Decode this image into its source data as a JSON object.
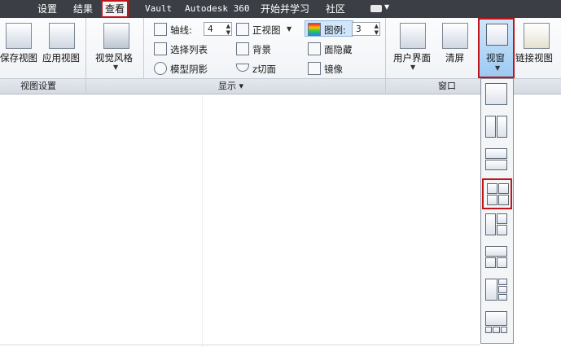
{
  "topbar": {
    "tabs": [
      {
        "label": "设置"
      },
      {
        "label": "结果"
      },
      {
        "label": "查看"
      },
      {
        "label": "Vault"
      },
      {
        "label": "Autodesk 360"
      },
      {
        "label": "开始并学习"
      },
      {
        "label": "社区"
      }
    ]
  },
  "ribbon": {
    "view_settings": {
      "save_view": "保存视图",
      "apply_view": "应用视图",
      "panel_title": "视图设置"
    },
    "visual_style": {
      "label": "视觉风格"
    },
    "display": {
      "axis_label": "轴线:",
      "axis_value": "4",
      "ortho_view": "正视图",
      "select_list": "选择列表",
      "background": "背景",
      "model_shadow": "模型阴影",
      "z_cut": "z切面",
      "legend_label": "图例:",
      "legend_value": "3",
      "hide_faces": "面隐藏",
      "mirror": "镜像",
      "panel_title": "显示 ▾"
    },
    "window": {
      "user_interface": "用户界面",
      "clear_screen": "清屏",
      "viewport": "视窗",
      "link_view": "链接视图",
      "panel_title": "窗口"
    }
  },
  "viewport_dropdown": {
    "layouts": [
      {
        "name": "single"
      },
      {
        "name": "two-vertical"
      },
      {
        "name": "two-horizontal"
      },
      {
        "name": "four-grid",
        "selected": true
      },
      {
        "name": "three-left-large"
      },
      {
        "name": "three-top-large"
      },
      {
        "name": "four-left-large"
      },
      {
        "name": "four-bottom-row"
      }
    ]
  },
  "colors": {
    "topbar_bg": "#3b3f45",
    "highlight_border": "#c0141b",
    "selected_button_bg": "#9ccaf2"
  }
}
